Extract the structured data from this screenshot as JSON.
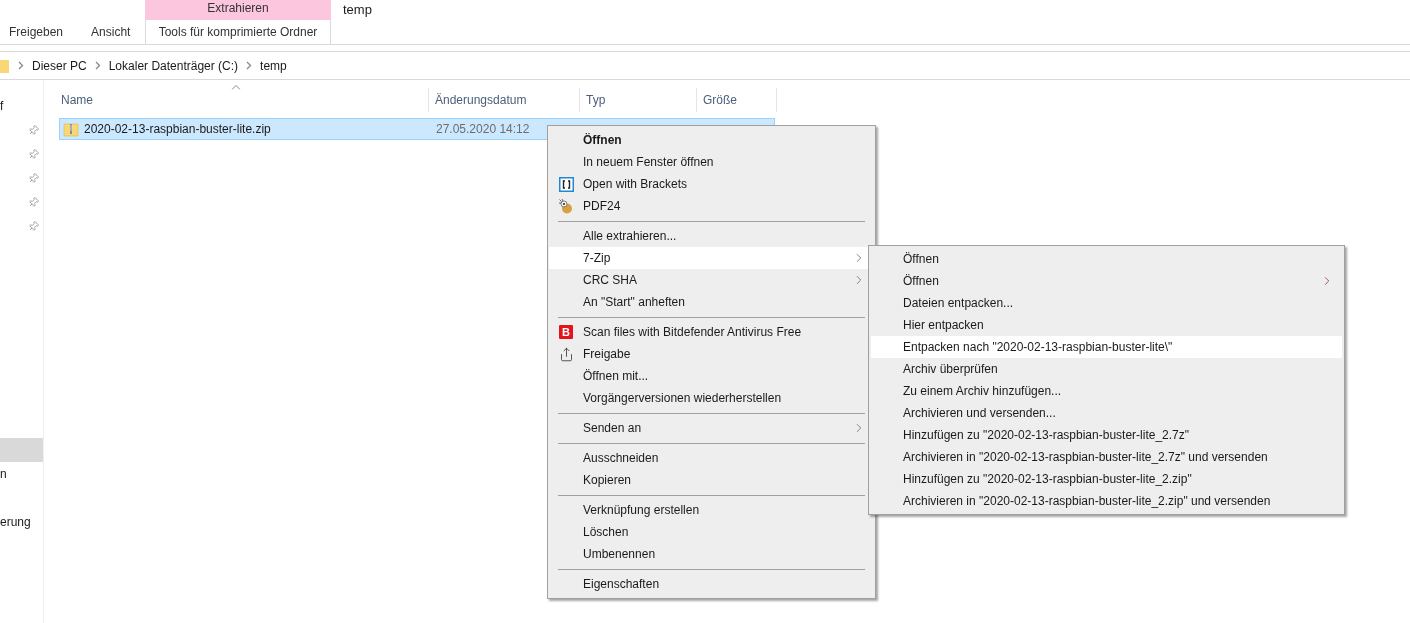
{
  "ribbon": {
    "tabs": [
      {
        "label": "Freigeben",
        "selected": false
      },
      {
        "label": "Ansicht",
        "selected": false
      }
    ],
    "context_tab": {
      "group": "Extrahieren",
      "label": "Tools für komprimierte Ordner"
    },
    "title": "temp"
  },
  "address": {
    "crumbs": [
      "Dieser PC",
      "Lokaler Datenträger (C:)",
      "temp"
    ]
  },
  "sidebar": {
    "quick_access": [
      {
        "label": "f",
        "pinned": false,
        "selected": false
      },
      {
        "pinned": true,
        "selected": false
      },
      {
        "pinned": true,
        "selected": false
      },
      {
        "pinned": true,
        "selected": false
      },
      {
        "pinned": true,
        "selected": false
      },
      {
        "pinned": true,
        "selected": false
      }
    ],
    "lower": [
      {
        "selected": true
      },
      {
        "label": "n",
        "selected": false
      }
    ],
    "bottom": [
      {
        "label": "erung",
        "selected": false
      }
    ]
  },
  "table": {
    "columns": [
      {
        "label": "Name",
        "sorted": true
      },
      {
        "label": "Änderungsdatum",
        "sorted": false
      },
      {
        "label": "Typ",
        "sorted": false
      },
      {
        "label": "Größe",
        "sorted": false
      }
    ],
    "rows": [
      {
        "name": "2020-02-13-raspbian-buster-lite.zip",
        "date": "27.05.2020 14:12",
        "selected": true
      }
    ]
  },
  "context_menu": {
    "items": [
      {
        "kind": "plain",
        "label": "Öffnen",
        "bold": true,
        "submenu": false,
        "selected": false
      },
      {
        "kind": "plain",
        "label": "In neuem Fenster öffnen",
        "bold": false,
        "submenu": false,
        "selected": false
      },
      {
        "kind": "brackets",
        "label": "Open with Brackets",
        "bold": false,
        "submenu": false,
        "selected": false
      },
      {
        "kind": "pdf24",
        "label": "PDF24",
        "bold": false,
        "submenu": false,
        "selected": false
      },
      {
        "kind": "separator"
      },
      {
        "kind": "plain",
        "label": "Alle extrahieren...",
        "bold": false,
        "submenu": false,
        "selected": false
      },
      {
        "kind": "plain",
        "label": "7-Zip",
        "bold": false,
        "submenu": true,
        "selected": true
      },
      {
        "kind": "plain",
        "label": "CRC SHA",
        "bold": false,
        "submenu": true,
        "selected": false
      },
      {
        "kind": "plain",
        "label": "An \"Start\" anheften",
        "bold": false,
        "submenu": false,
        "selected": false
      },
      {
        "kind": "separator"
      },
      {
        "kind": "bitdefender",
        "label": "Scan files with Bitdefender Antivirus Free",
        "icon_text": "B",
        "bold": false,
        "submenu": false,
        "selected": false
      },
      {
        "kind": "share",
        "label": "Freigabe",
        "bold": false,
        "submenu": false,
        "selected": false
      },
      {
        "kind": "plain",
        "label": "Öffnen mit...",
        "bold": false,
        "submenu": false,
        "selected": false
      },
      {
        "kind": "plain",
        "label": "Vorgängerversionen wiederherstellen",
        "bold": false,
        "submenu": false,
        "selected": false
      },
      {
        "kind": "separator"
      },
      {
        "kind": "plain",
        "label": "Senden an",
        "bold": false,
        "submenu": true,
        "selected": false
      },
      {
        "kind": "separator"
      },
      {
        "kind": "plain",
        "label": "Ausschneiden",
        "bold": false,
        "submenu": false,
        "selected": false
      },
      {
        "kind": "plain",
        "label": "Kopieren",
        "bold": false,
        "submenu": false,
        "selected": false
      },
      {
        "kind": "separator"
      },
      {
        "kind": "plain",
        "label": "Verknüpfung erstellen",
        "bold": false,
        "submenu": false,
        "selected": false
      },
      {
        "kind": "plain",
        "label": "Löschen",
        "bold": false,
        "submenu": false,
        "selected": false
      },
      {
        "kind": "plain",
        "label": "Umbenennen",
        "bold": false,
        "submenu": false,
        "selected": false
      },
      {
        "kind": "separator"
      },
      {
        "kind": "plain",
        "label": "Eigenschaften",
        "bold": false,
        "submenu": false,
        "selected": false
      }
    ]
  },
  "submenu": {
    "items": [
      {
        "label": "Öffnen",
        "submenu": false,
        "selected": false
      },
      {
        "label": "Öffnen",
        "submenu": true,
        "selected": false
      },
      {
        "label": "Dateien entpacken...",
        "submenu": false,
        "selected": false
      },
      {
        "label": "Hier entpacken",
        "submenu": false,
        "selected": false
      },
      {
        "label": "Entpacken nach \"2020-02-13-raspbian-buster-lite\\\"",
        "submenu": false,
        "selected": true
      },
      {
        "label": "Archiv überprüfen",
        "submenu": false,
        "selected": false
      },
      {
        "label": "Zu einem Archiv hinzufügen...",
        "submenu": false,
        "selected": false
      },
      {
        "label": "Archivieren und versenden...",
        "submenu": false,
        "selected": false
      },
      {
        "label": "Hinzufügen zu \"2020-02-13-raspbian-buster-lite_2.7z\"",
        "submenu": false,
        "selected": false
      },
      {
        "label": "Archivieren in \"2020-02-13-raspbian-buster-lite_2.7z\" und versenden",
        "submenu": false,
        "selected": false
      },
      {
        "label": "Hinzufügen zu \"2020-02-13-raspbian-buster-lite_2.zip\"",
        "submenu": false,
        "selected": false
      },
      {
        "label": "Archivieren in \"2020-02-13-raspbian-buster-lite_2.zip\" und versenden",
        "submenu": false,
        "selected": false
      }
    ]
  }
}
